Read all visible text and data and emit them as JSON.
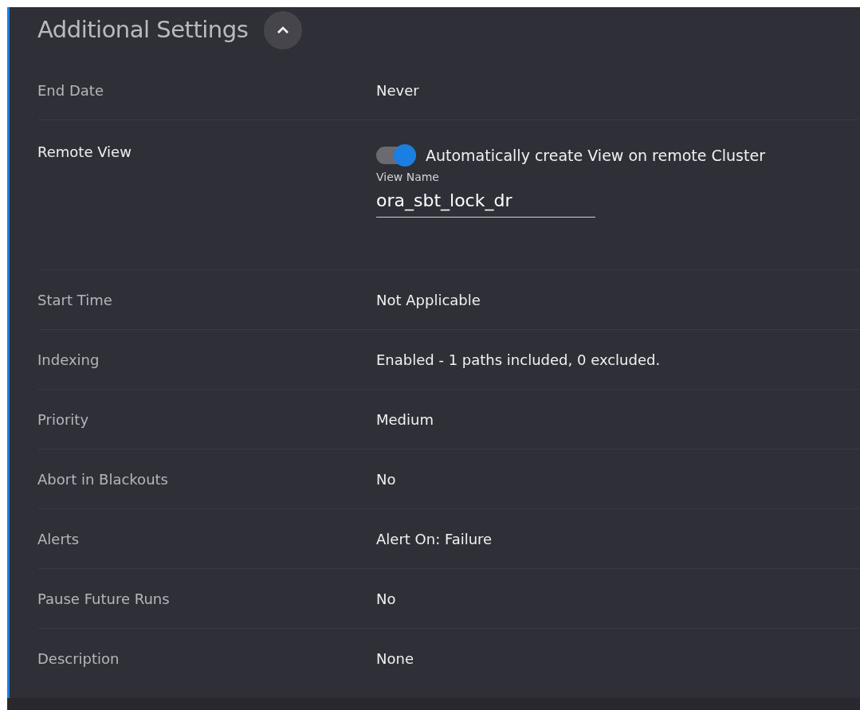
{
  "section": {
    "title": "Additional Settings",
    "expanded": true
  },
  "rows": [
    {
      "kind": "text",
      "label": "End Date",
      "value": "Never"
    },
    {
      "kind": "toggle",
      "label": "Remote View",
      "toggle_label": "Automatically create View on remote Cluster",
      "on": true,
      "field_label": "View Name",
      "field_value": "ora_sbt_lock_dr"
    },
    {
      "kind": "text",
      "label": "Start Time",
      "value": "Not Applicable"
    },
    {
      "kind": "text",
      "label": "Indexing",
      "value": "Enabled - 1 paths included, 0 excluded."
    },
    {
      "kind": "text",
      "label": "Priority",
      "value": "Medium"
    },
    {
      "kind": "text",
      "label": "Abort in Blackouts",
      "value": "No"
    },
    {
      "kind": "text",
      "label": "Alerts",
      "value": "Alert On: Failure"
    },
    {
      "kind": "text",
      "label": "Pause Future Runs",
      "value": "No"
    },
    {
      "kind": "text",
      "label": "Description",
      "value": "None"
    }
  ]
}
